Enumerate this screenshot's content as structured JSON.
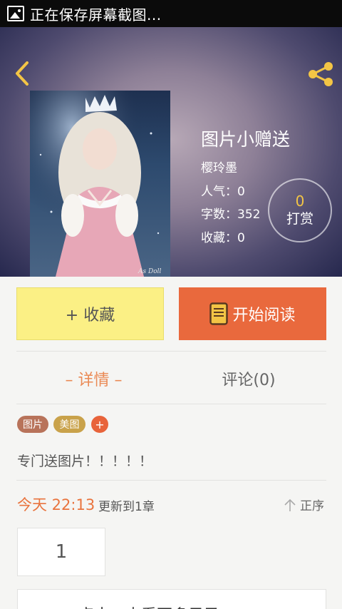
{
  "status_bar": {
    "text": "正在保存屏幕截图..."
  },
  "book": {
    "title": "图片小赠送",
    "author": "樱玲墨",
    "popularity": "人气：0",
    "word_count": "字数：352",
    "favorites": "收藏：0",
    "reward_count": "0",
    "reward_label": "打赏",
    "cover_watermark": "As Doll"
  },
  "actions": {
    "favorite_label": "+ 收藏",
    "read_label": "开始阅读"
  },
  "tabs": [
    {
      "label": "– 详情 –"
    },
    {
      "label": "评论(0)"
    }
  ],
  "tags": [
    {
      "label": "图片"
    },
    {
      "label": "美图"
    },
    {
      "label": "+"
    }
  ],
  "description": "专门送图片！！！！！",
  "update": {
    "time": "今天 22:13",
    "text": "更新到1章",
    "sort_label": "正序"
  },
  "chapters": [
    {
      "label": "1"
    }
  ],
  "bottom": {
    "text": "点击，查看更多目录"
  },
  "colors": {
    "accent": "#e9693d",
    "favorite_bg": "#fbf085",
    "icon_yellow": "#f3c545"
  },
  "icons": {
    "back": "chevron-left-icon",
    "share": "share-icon",
    "read": "book-icon",
    "sort": "arrow-up-icon"
  }
}
